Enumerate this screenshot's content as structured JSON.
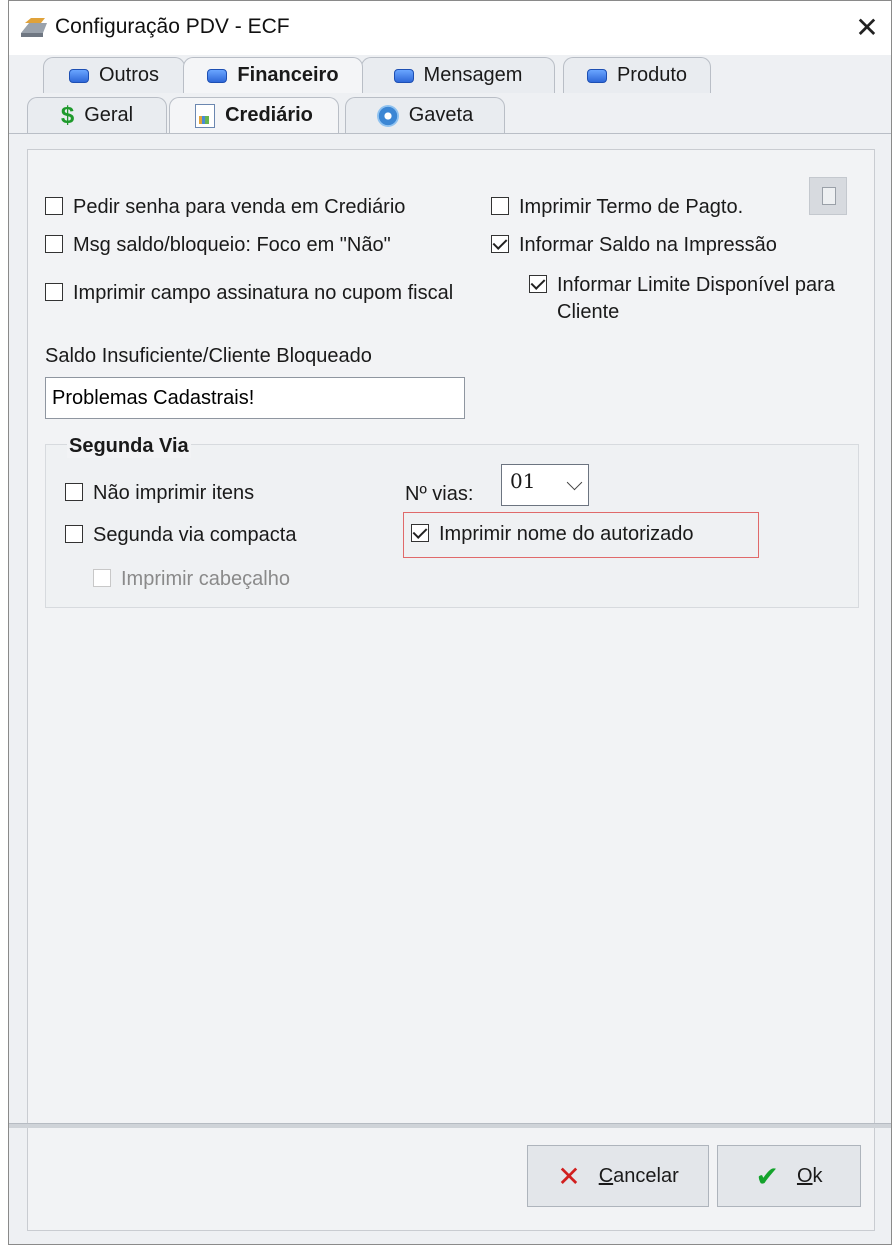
{
  "window": {
    "title": "Configuração PDV - ECF",
    "close_glyph": "✕",
    "title_icon": "printer-icon"
  },
  "tabs_row1": [
    {
      "label": "Outros",
      "icon": "tab-icon",
      "active": false
    },
    {
      "label": "Financeiro",
      "icon": "tab-icon",
      "active": true
    },
    {
      "label": "Mensagem",
      "icon": "tab-icon",
      "active": false
    },
    {
      "label": "Produto",
      "icon": "tab-icon",
      "active": false
    }
  ],
  "tabs_row2": [
    {
      "label": "Geral",
      "icon": "dollar-icon",
      "active": false
    },
    {
      "label": "Crediário",
      "icon": "report-icon",
      "active": true
    },
    {
      "label": "Gaveta",
      "icon": "gear-icon",
      "active": false
    }
  ],
  "options": {
    "pedir_senha": {
      "label": "Pedir senha para venda em Crediário",
      "checked": false
    },
    "msg_saldo": {
      "label": "Msg saldo/bloqueio: Foco em \"Não\"",
      "checked": false
    },
    "imprimir_assinatura": {
      "label": "Imprimir campo assinatura no cupom fiscal",
      "checked": false
    },
    "imprimir_termo": {
      "label": "Imprimir Termo de Pagto.",
      "checked": false
    },
    "informar_saldo": {
      "label": "Informar Saldo na Impressão",
      "checked": true
    },
    "informar_limite": {
      "label": "Informar Limite Disponível para Cliente",
      "checked": true
    }
  },
  "saldo_field": {
    "label": "Saldo Insuficiente/Cliente Bloqueado",
    "value": "Problemas Cadastrais!"
  },
  "segunda_via": {
    "title": "Segunda Via",
    "nao_imprimir_itens": {
      "label": "Não imprimir itens",
      "checked": false
    },
    "segunda_via_compacta": {
      "label": "Segunda via compacta",
      "checked": false
    },
    "imprimir_cabecalho": {
      "label": "Imprimir cabeçalho",
      "checked": false,
      "enabled": false
    },
    "num_vias_label": "Nº vias:",
    "num_vias_value": "01",
    "imprimir_nome_autorizado": {
      "label": "Imprimir nome do autorizado",
      "checked": true
    }
  },
  "buttons": {
    "cancelar_first": "C",
    "cancelar_rest": "ancelar",
    "ok_first": "O",
    "ok_rest": "k"
  }
}
